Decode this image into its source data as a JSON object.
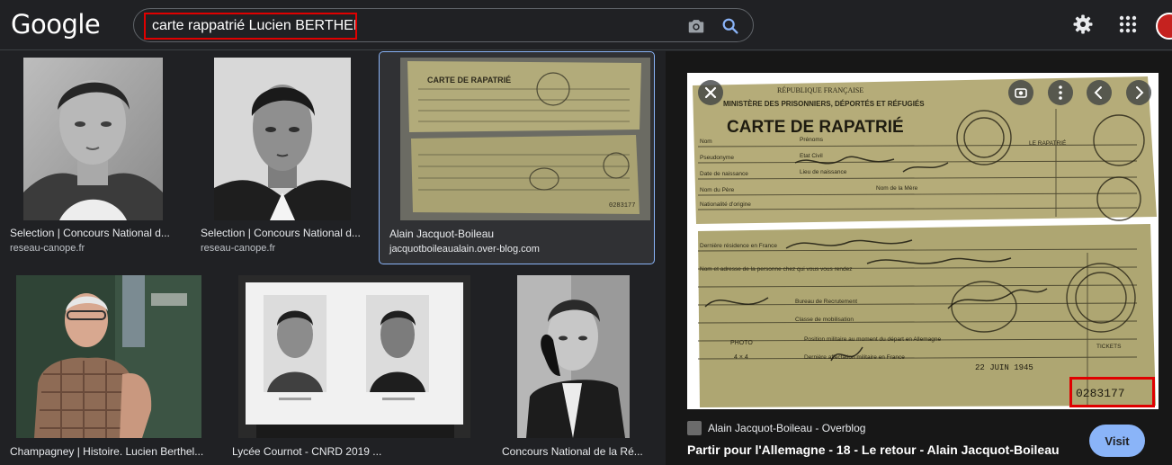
{
  "header": {
    "logo": "Google",
    "search_query": "carte rappatrié Lucien BERTHEL"
  },
  "results": [
    {
      "title": "Selection | Concours National d...",
      "source": "reseau-canope.fr"
    },
    {
      "title": "Selection | Concours National d...",
      "source": "reseau-canope.fr"
    },
    {
      "title": "Alain Jacquot-Boileau",
      "source": "jacquotboileaualain.over-blog.com"
    },
    {
      "title": "Champagney | Histoire. Lucien Berthel..."
    },
    {
      "title": "Lycée Cournot - CNRD 2019 ..."
    },
    {
      "title": "Concours National de la Ré..."
    }
  ],
  "thumb_text": {
    "card_heading": "CARTE DE RAPATRIÉ",
    "card_number": "0283177"
  },
  "preview": {
    "republic": "RÉPUBLIQUE FRANÇAISE",
    "ministry": "MINISTÈRE DES PRISONNIERS, DÉPORTÉS ET RÉFUGIÉS",
    "heading": "CARTE DE RAPATRIÉ",
    "number": "0283177",
    "stamp_date": "22 JUIN 1945",
    "tickets": "TICKETS",
    "photo": "PHOTO",
    "photo_size": "4 × 4",
    "repatrie": "LE RAPATRIÉ",
    "form_labels": [
      "Nom",
      "Prénoms",
      "Pseudonyme",
      "Etat Civil",
      "Date de naissance",
      "Lieu de naissance",
      "Nom du Père",
      "Nom de la Mère",
      "Nationalité d'origine",
      "Dernière résidence en France",
      "Nom et adresse de la personne chez qui vous vous rendez",
      "Bureau de Recrutement",
      "Classe de mobilisation",
      "Position militaire au moment du départ en Allemagne",
      "Dernière affectation militaire en France"
    ],
    "source_name": "Alain Jacquot-Boileau - Overblog",
    "title": "Partir pour l'Allemagne - 18 - Le retour - Alain Jacquot-Boileau",
    "visit_label": "Visit"
  }
}
